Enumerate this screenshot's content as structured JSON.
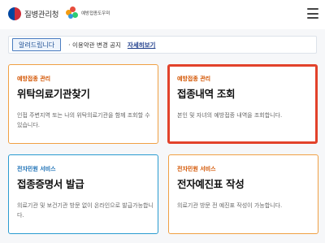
{
  "header": {
    "gov_logo_text": "질병관리청",
    "brand_logo_text": "예방접종도우미",
    "menu_icon": "hamburger-menu-icon"
  },
  "notice": {
    "badge": "알려드립니다",
    "text": "· 이용약관 변경 공지",
    "link": "자세히보기"
  },
  "cards": [
    {
      "category": "예방접종 관리",
      "title": "위탁의료기관찾기",
      "description": "인접 주변지역 또는 나의 위탁의료기관을 함께 조회할 수 있습니다."
    },
    {
      "category": "예방접종 관리",
      "title": "접종내역 조회",
      "description": "본인 및 자녀의 예방접종 내역을 조회합니다."
    },
    {
      "category": "전자민원 서비스",
      "title": "접종증명서 발급",
      "description": "의료기관 및 보건기관 방문 없이 온라인으로 발급가능합니다."
    },
    {
      "category": "전자민원 서비스",
      "title": "전자예진표 작성",
      "description": "의료기관 방문 전 예진표 작성이 가능합니다."
    }
  ],
  "colors": {
    "accent_orange": "#f0a044",
    "accent_blue": "#2a9bd0",
    "selection_red": "#e2422b"
  }
}
